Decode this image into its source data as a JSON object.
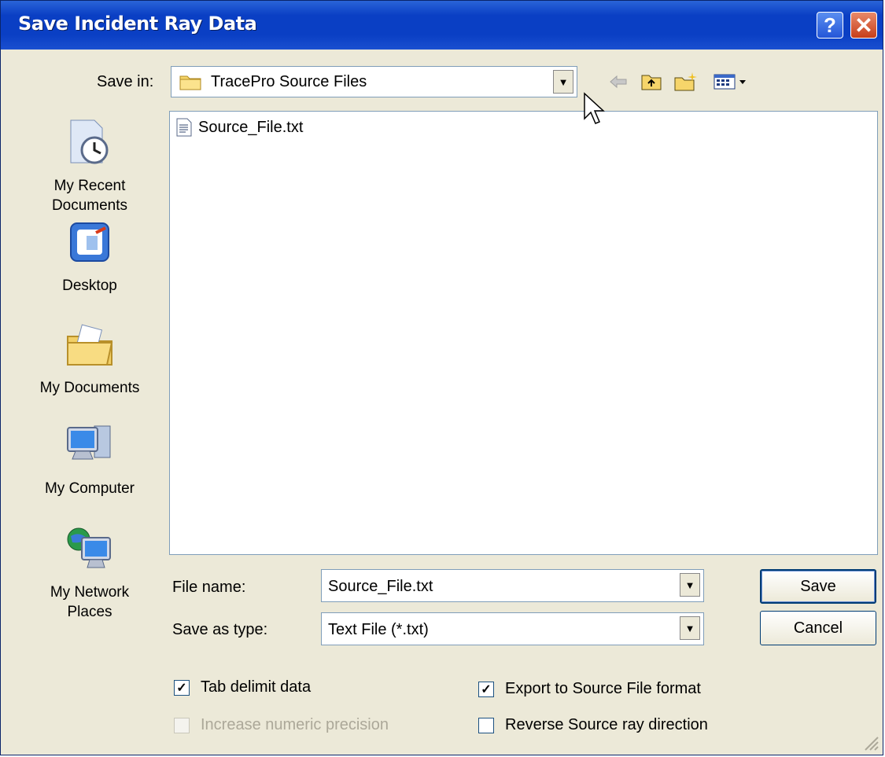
{
  "window": {
    "title": "Save Incident Ray Data",
    "help_icon_glyph": "?",
    "close_icon_glyph": "✕"
  },
  "save_in": {
    "label": "Save in:",
    "value": "TracePro Source Files"
  },
  "toolbar": {
    "icons": [
      "back-arrow-icon",
      "up-one-level-icon",
      "create-new-folder-icon",
      "view-menu-icon"
    ]
  },
  "places": [
    {
      "label": "My Recent Documents",
      "icon": "recent-documents-icon"
    },
    {
      "label": "Desktop",
      "icon": "desktop-icon"
    },
    {
      "label": "My Documents",
      "icon": "my-documents-icon"
    },
    {
      "label": "My Computer",
      "icon": "my-computer-icon"
    },
    {
      "label": "My Network Places",
      "icon": "network-places-icon"
    }
  ],
  "files": [
    {
      "name": "Source_File.txt",
      "icon": "text-file-icon"
    }
  ],
  "form": {
    "file_name_label": "File name:",
    "file_name_value": "Source_File.txt",
    "save_type_label": "Save as type:",
    "save_type_value": "Text File (*.txt)"
  },
  "buttons": {
    "save": "Save",
    "cancel": "Cancel"
  },
  "options": {
    "tab_delimit": {
      "label": "Tab delimit data",
      "checked": true,
      "enabled": true
    },
    "increase_precision": {
      "label": "Increase numeric precision",
      "checked": false,
      "enabled": false
    },
    "export_source": {
      "label": "Export to Source File format",
      "checked": true,
      "enabled": true
    },
    "reverse_direction": {
      "label": "Reverse Source ray direction",
      "checked": false,
      "enabled": true
    }
  },
  "colors": {
    "titlebar": "#0a3fc4",
    "dialog_bg": "#ece9d8",
    "input_border": "#7f9db9"
  }
}
